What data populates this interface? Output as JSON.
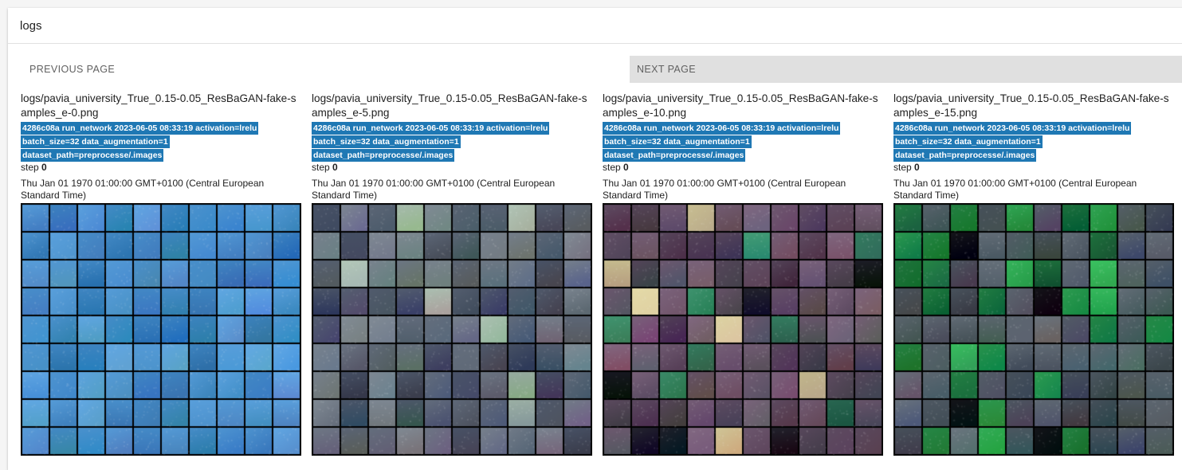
{
  "header": {
    "title": "logs"
  },
  "pager": {
    "previous_label": "PREVIOUS PAGE",
    "next_label": "NEXT PAGE"
  },
  "images": [
    {
      "title": "logs/pavia_university_True_0.15-0.05_ResBaGAN-fake-samples_e-0.png",
      "tag_line1": " 4286c08a run_network 2023-06-05 08:33:19 activation=lrelu",
      "tag_line2": "batch_size=32 data_augmentation=1",
      "tag_line3": "dataset_path=preprocesse/.images",
      "step_label": "step",
      "step_value": "0",
      "wall_time": "Thu Jan 01 1970 01:00:00 GMT+0100 (Central European Standard Time)",
      "palette": "blue"
    },
    {
      "title": "logs/pavia_university_True_0.15-0.05_ResBaGAN-fake-samples_e-5.png",
      "tag_line1": " 4286c08a run_network 2023-06-05 08:33:19 activation=lrelu",
      "tag_line2": "batch_size=32 data_augmentation=1",
      "tag_line3": "dataset_path=preprocesse/.images",
      "step_label": "step",
      "step_value": "0",
      "wall_time": "Thu Jan 01 1970 01:00:00 GMT+0100 (Central European Standard Time)",
      "palette": "slate"
    },
    {
      "title": "logs/pavia_university_True_0.15-0.05_ResBaGAN-fake-samples_e-10.png",
      "tag_line1": " 4286c08a run_network 2023-06-05 08:33:19 activation=lrelu",
      "tag_line2": "batch_size=32 data_augmentation=1",
      "tag_line3": "dataset_path=preprocesse/.images",
      "step_label": "step",
      "step_value": "0",
      "wall_time": "Thu Jan 01 1970 01:00:00 GMT+0100 (Central European Standard Time)",
      "palette": "purple"
    },
    {
      "title": "logs/pavia_university_True_0.15-0.05_ResBaGAN-fake-samples_e-15.png",
      "tag_line1": " 4286c08a run_network 2023-06-05 08:33:19 activation=lrelu",
      "tag_line2": "batch_size=32 data_augmentation=1",
      "tag_line3": "dataset_path=preprocesse/.images",
      "step_label": "step",
      "step_value": "0",
      "wall_time": "Thu Jan 01 1970 01:00:00 GMT+0100 (Central European Standard Time)",
      "palette": "green"
    }
  ],
  "colors": {
    "tag_bg": "#1f78b4",
    "next_bg": "#e0e0e0"
  }
}
